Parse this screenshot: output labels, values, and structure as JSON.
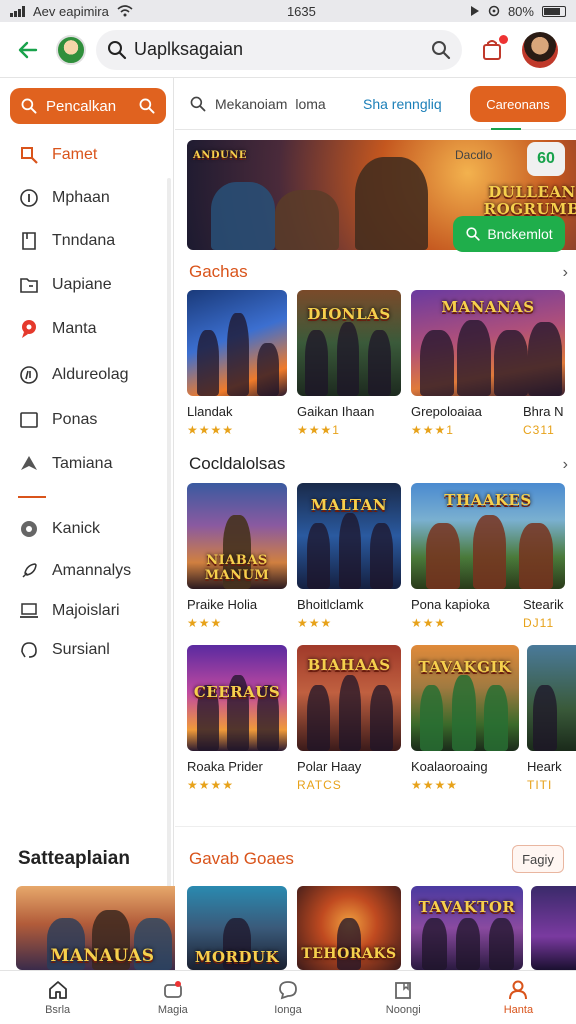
{
  "status_bar": {
    "carrier": "Aev eapimira",
    "time": "1635",
    "battery": "80%",
    "icons": [
      "signal-icon",
      "wifi-icon",
      "location-icon",
      "battery-icon"
    ]
  },
  "header": {
    "search_text": "Uaplksagaian",
    "icons": [
      "back-arrow-icon",
      "search-icon",
      "cart-icon"
    ]
  },
  "sidebar": {
    "search_button": "Pencalkan",
    "items": [
      {
        "label": "Famet",
        "icon": "search-icon",
        "active": true
      },
      {
        "label": "Mphaan",
        "icon": "info-icon"
      },
      {
        "label": "Tnndana",
        "icon": "bookmark-icon"
      },
      {
        "label": "Uapiane",
        "icon": "folder-icon"
      },
      {
        "label": "Manta",
        "icon": "map-pin-icon"
      },
      {
        "label": "Aldureolag",
        "icon": "music-icon"
      },
      {
        "label": "Ponas",
        "icon": "square-icon"
      },
      {
        "label": "Tamiana",
        "icon": "shield-icon"
      }
    ],
    "items2": [
      {
        "label": "Kanick",
        "icon": "gear-icon"
      },
      {
        "label": "Amannalys",
        "icon": "rocket-icon"
      },
      {
        "label": "Majoislari",
        "icon": "laptop-icon"
      },
      {
        "label": "Sursianl",
        "icon": "headset-icon"
      }
    ],
    "section_title": "Satteaplaian",
    "card_art": "MANAUAS"
  },
  "tabs": {
    "search_label": "Mekanoiam",
    "search_label2": "loma",
    "link": "Sha renngliq",
    "button": "Careonans"
  },
  "hero": {
    "art_text": "DULLEAN ROGRUMB",
    "corner_art": "ANDUNE",
    "label": "Dacdlo",
    "badge": "60",
    "cta": "Bnckemlot"
  },
  "sections": {
    "s1_title": "Gachas",
    "s2_title": "Cocldalolsas",
    "s3_title": "Gavab Goaes",
    "s3_pill": "Fagiy"
  },
  "cards_row1": [
    {
      "name": "Llandak",
      "rating": "★★★★",
      "art": ""
    },
    {
      "name": "Gaikan Ihaan",
      "rating": "★★★1",
      "art": "DIONLAS"
    },
    {
      "name": "Grepoloaiaa",
      "rating": "★★★1",
      "art": "MANANAS"
    },
    {
      "name": "Bhra N",
      "rating": "C311",
      "art": ""
    }
  ],
  "cards_row2": [
    {
      "name": "Praike Holia",
      "rating": "★★★",
      "art": "NIABAS MANUM"
    },
    {
      "name": "Bhoitlclamk",
      "rating": "★★★",
      "art": "MALTAN"
    },
    {
      "name": "Pona kapioka",
      "rating": "★★★",
      "art": "THAAKES"
    },
    {
      "name": "Stearik",
      "rating": "DJ11",
      "art": ""
    }
  ],
  "cards_row3": [
    {
      "name": "Roaka Prider",
      "rating": "★★★★",
      "art": "CEERAUS"
    },
    {
      "name": "Polar Haay",
      "rating": "RATCS",
      "art": "BIAHAAS"
    },
    {
      "name": "Koalaoroaing",
      "rating": "★★★★",
      "art": "TAVAKGIK"
    },
    {
      "name": "Heark",
      "rating": "TITI",
      "art": ""
    }
  ],
  "cards_row4": [
    {
      "art": "MORDUK"
    },
    {
      "art": "TEHORAKS"
    },
    {
      "art": "TAVAKTOR"
    },
    {
      "art": ""
    }
  ],
  "bottom_nav": [
    {
      "label": "Bsrla",
      "icon": "home-icon"
    },
    {
      "label": "Magia",
      "icon": "gamepad-icon"
    },
    {
      "label": "Ionga",
      "icon": "chat-icon"
    },
    {
      "label": "Noongi",
      "icon": "bookmark-icon"
    },
    {
      "label": "Hanta",
      "icon": "person-icon",
      "active": true
    }
  ]
}
